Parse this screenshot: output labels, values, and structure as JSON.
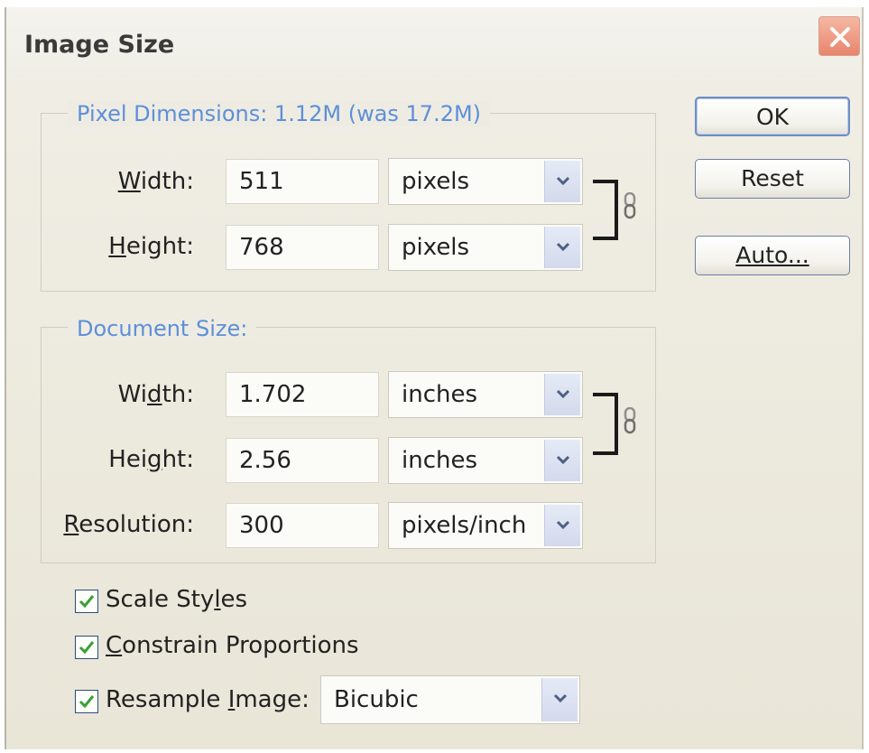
{
  "window": {
    "title": "Image Size"
  },
  "pixel_dimensions": {
    "title": "Pixel Dimensions:  1.12M (was 17.2M)",
    "width": {
      "label": "Width:",
      "value": "511",
      "unit": "pixels"
    },
    "height": {
      "label": "Height:",
      "value": "768",
      "unit": "pixels"
    }
  },
  "document_size": {
    "title": "Document Size:",
    "width": {
      "label": "Width:",
      "value": "1.702",
      "unit": "inches"
    },
    "height": {
      "label": "Height:",
      "value": "2.56",
      "unit": "inches"
    },
    "resolution": {
      "label": "Resolution:",
      "value": "300",
      "unit": "pixels/inch"
    }
  },
  "buttons": {
    "ok": "OK",
    "reset": "Reset",
    "auto": "Auto..."
  },
  "options": {
    "scale_styles": {
      "label": "Scale Styles",
      "checked": true
    },
    "constrain_proportions": {
      "label": "Constrain Proportions",
      "checked": true
    },
    "resample_image": {
      "label": "Resample Image:",
      "checked": true,
      "method": "Bicubic"
    }
  },
  "colors": {
    "group_title": "#5d8fd9",
    "check": "#3aa035",
    "close": "#e9846c"
  },
  "icons": [
    "close-icon",
    "chevron-down-icon",
    "chain-link-icon",
    "checkmark-icon"
  ]
}
